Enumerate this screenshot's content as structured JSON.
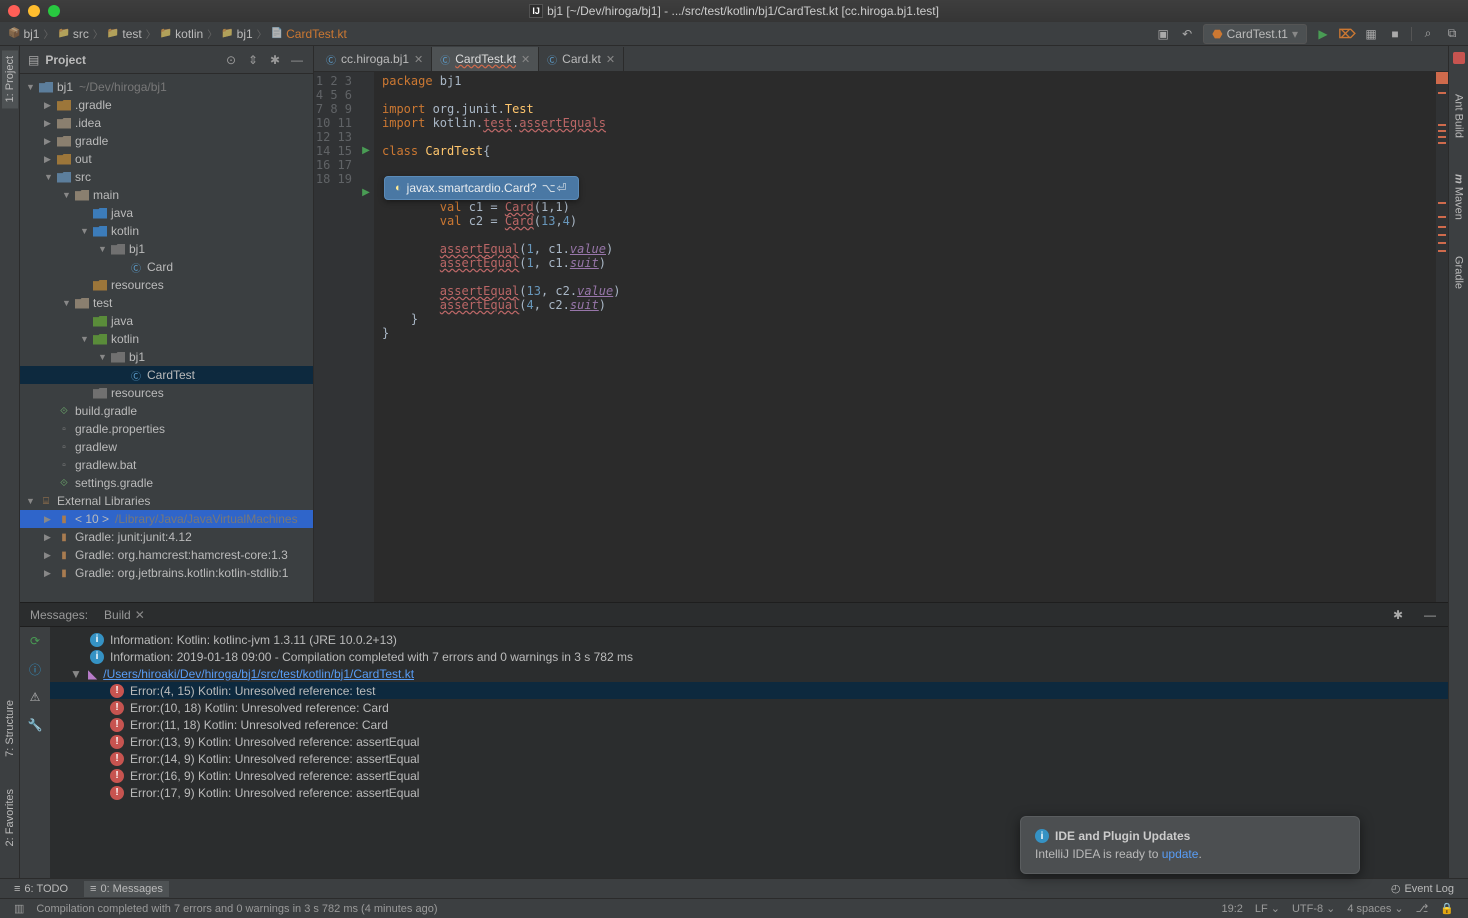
{
  "titlebar": {
    "title": "bj1 [~/Dev/hiroga/bj1] - .../src/test/kotlin/bj1/CardTest.kt [cc.hiroga.bj1.test]",
    "appIcon": "IJ"
  },
  "breadcrumb": [
    "bj1",
    "src",
    "test",
    "kotlin",
    "bj1",
    "CardTest.kt"
  ],
  "runConfig": {
    "label": "CardTest.t1"
  },
  "toolbarIcons": {
    "layout": "▣",
    "back": "↶",
    "run": "▶",
    "debug": "⌦",
    "coverage": "▦",
    "stop": "■",
    "search": "⌕",
    "structure": "⧉"
  },
  "projectPanel": {
    "title": "Project",
    "icons": {
      "target": "⊙",
      "collapse": "⇕",
      "gear": "✱",
      "hide": "—"
    },
    "tree": [
      {
        "d": 0,
        "arrow": "▼",
        "icon": "mod",
        "text": "bj1",
        "hint": "~/Dev/hiroga/bj1",
        "sel": false
      },
      {
        "d": 1,
        "arrow": "▶",
        "icon": "dirx",
        "text": ".gradle"
      },
      {
        "d": 1,
        "arrow": "▶",
        "icon": "dir",
        "text": ".idea"
      },
      {
        "d": 1,
        "arrow": "▶",
        "icon": "dir",
        "text": "gradle"
      },
      {
        "d": 1,
        "arrow": "▶",
        "icon": "dirx",
        "text": "out"
      },
      {
        "d": 1,
        "arrow": "▼",
        "icon": "mod",
        "text": "src"
      },
      {
        "d": 2,
        "arrow": "▼",
        "icon": "dir",
        "text": "main"
      },
      {
        "d": 3,
        "arrow": "",
        "icon": "src",
        "text": "java"
      },
      {
        "d": 3,
        "arrow": "▼",
        "icon": "src",
        "text": "kotlin"
      },
      {
        "d": 4,
        "arrow": "▼",
        "icon": "pkg",
        "text": "bj1"
      },
      {
        "d": 5,
        "arrow": "",
        "icon": "class",
        "text": "Card"
      },
      {
        "d": 3,
        "arrow": "",
        "icon": "res",
        "text": "resources"
      },
      {
        "d": 2,
        "arrow": "▼",
        "icon": "dir",
        "text": "test"
      },
      {
        "d": 3,
        "arrow": "",
        "icon": "test",
        "text": "java"
      },
      {
        "d": 3,
        "arrow": "▼",
        "icon": "test",
        "text": "kotlin"
      },
      {
        "d": 4,
        "arrow": "▼",
        "icon": "pkg",
        "text": "bj1"
      },
      {
        "d": 5,
        "arrow": "",
        "icon": "class",
        "text": "CardTest",
        "sel": true
      },
      {
        "d": 3,
        "arrow": "",
        "icon": "resg",
        "text": "resources"
      },
      {
        "d": 1,
        "arrow": "",
        "icon": "gradle",
        "text": "build.gradle"
      },
      {
        "d": 1,
        "arrow": "",
        "icon": "file",
        "text": "gradle.properties"
      },
      {
        "d": 1,
        "arrow": "",
        "icon": "file",
        "text": "gradlew"
      },
      {
        "d": 1,
        "arrow": "",
        "icon": "file",
        "text": "gradlew.bat"
      },
      {
        "d": 1,
        "arrow": "",
        "icon": "gradle",
        "text": "settings.gradle"
      },
      {
        "d": 0,
        "arrow": "▼",
        "icon": "lib",
        "text": "External Libraries"
      },
      {
        "d": 1,
        "arrow": "▶",
        "icon": "jar",
        "text": "< 10 >",
        "hint": "/Library/Java/JavaVirtualMachines",
        "sel": "hl"
      },
      {
        "d": 1,
        "arrow": "▶",
        "icon": "jar",
        "text": "Gradle: junit:junit:4.12"
      },
      {
        "d": 1,
        "arrow": "▶",
        "icon": "jar",
        "text": "Gradle: org.hamcrest:hamcrest-core:1.3"
      },
      {
        "d": 1,
        "arrow": "▶",
        "icon": "jar",
        "text": "Gradle: org.jetbrains.kotlin:kotlin-stdlib:1"
      }
    ]
  },
  "editorTabs": [
    {
      "name": "cc.hiroga.bj1",
      "icon": "kt",
      "err": false,
      "active": false
    },
    {
      "name": "CardTest.kt",
      "icon": "kt",
      "err": true,
      "active": true
    },
    {
      "name": "Card.kt",
      "icon": "kt",
      "err": false,
      "active": false
    }
  ],
  "code": {
    "lines": 19,
    "runMarkers": [
      6,
      9
    ],
    "tokens": [
      [
        [
          "kw",
          "package"
        ],
        [
          "pkg",
          " bj1"
        ]
      ],
      [],
      [
        [
          "kw",
          "import"
        ],
        [
          "pkg",
          " org.junit."
        ],
        [
          "cls",
          "Test"
        ]
      ],
      [
        [
          "kw",
          "import"
        ],
        [
          "pkg",
          " kotlin."
        ],
        [
          "unres",
          "test"
        ],
        [
          "pkg",
          "."
        ],
        [
          "unres",
          "assertEquals"
        ]
      ],
      [],
      [
        [
          "kw",
          "class"
        ],
        [
          "pkg",
          " "
        ],
        [
          "cls",
          "CardTest"
        ],
        [
          "pkg",
          "{"
        ]
      ],
      [],
      [],
      [],
      [
        [
          "pkg",
          "        "
        ],
        [
          "kw",
          "val"
        ],
        [
          "pkg",
          " c1 = "
        ],
        [
          "unres",
          "Card"
        ],
        [
          "pkg",
          "(1,1)"
        ]
      ],
      [
        [
          "pkg",
          "        "
        ],
        [
          "kw",
          "val"
        ],
        [
          "pkg",
          " c2 = "
        ],
        [
          "unres",
          "Card"
        ],
        [
          "pkg",
          "("
        ],
        [
          "num",
          "13"
        ],
        [
          "pkg",
          ","
        ],
        [
          "num",
          "4"
        ],
        [
          "pkg",
          ")"
        ]
      ],
      [],
      [
        [
          "pkg",
          "        "
        ],
        [
          "unres",
          "assertEqual"
        ],
        [
          "pkg",
          "("
        ],
        [
          "num",
          "1"
        ],
        [
          "pkg",
          ", c1."
        ],
        [
          "field-it",
          "value"
        ],
        [
          "pkg",
          ")"
        ]
      ],
      [
        [
          "pkg",
          "        "
        ],
        [
          "unres",
          "assertEqual"
        ],
        [
          "pkg",
          "("
        ],
        [
          "num",
          "1"
        ],
        [
          "pkg",
          ", c1."
        ],
        [
          "field-it",
          "suit"
        ],
        [
          "pkg",
          ")"
        ]
      ],
      [],
      [
        [
          "pkg",
          "        "
        ],
        [
          "unres",
          "assertEqual"
        ],
        [
          "pkg",
          "("
        ],
        [
          "num",
          "13"
        ],
        [
          "pkg",
          ", c2."
        ],
        [
          "field-it",
          "value"
        ],
        [
          "pkg",
          ")"
        ]
      ],
      [
        [
          "pkg",
          "        "
        ],
        [
          "unres",
          "assertEqual"
        ],
        [
          "pkg",
          "("
        ],
        [
          "num",
          "4"
        ],
        [
          "pkg",
          ", c2."
        ],
        [
          "field-it",
          "suit"
        ],
        [
          "pkg",
          ")"
        ]
      ],
      [
        [
          "pkg",
          "    }"
        ]
      ],
      [
        [
          "pkg",
          "}"
        ]
      ]
    ]
  },
  "hint": {
    "text": "javax.smartcardio.Card?",
    "shortcut": "⌥⏎"
  },
  "messages": {
    "tabs": [
      "Messages:",
      "Build"
    ],
    "rows": [
      {
        "d": 1,
        "icon": "info",
        "text": "Information: Kotlin: kotlinc-jvm 1.3.11 (JRE 10.0.2+13)"
      },
      {
        "d": 1,
        "icon": "info",
        "text": "Information: 2019-01-18 09:00 - Compilation completed with 7 errors and 0 warnings in 3 s 782 ms"
      },
      {
        "d": 0,
        "icon": "kt",
        "text": "/Users/hiroaki/Dev/hiroga/bj1/src/test/kotlin/bj1/CardTest.kt",
        "arrow": "▼"
      },
      {
        "d": 2,
        "icon": "err",
        "text": "Error:(4, 15)  Kotlin: Unresolved reference: test",
        "sel": true
      },
      {
        "d": 2,
        "icon": "err",
        "text": "Error:(10, 18)  Kotlin: Unresolved reference: Card"
      },
      {
        "d": 2,
        "icon": "err",
        "text": "Error:(11, 18)  Kotlin: Unresolved reference: Card"
      },
      {
        "d": 2,
        "icon": "err",
        "text": "Error:(13, 9)  Kotlin: Unresolved reference: assertEqual"
      },
      {
        "d": 2,
        "icon": "err",
        "text": "Error:(14, 9)  Kotlin: Unresolved reference: assertEqual"
      },
      {
        "d": 2,
        "icon": "err",
        "text": "Error:(16, 9)  Kotlin: Unresolved reference: assertEqual"
      },
      {
        "d": 2,
        "icon": "err",
        "text": "Error:(17, 9)  Kotlin: Unresolved reference: assertEqual"
      }
    ]
  },
  "updateBalloon": {
    "title": "IDE and Plugin Updates",
    "body_pre": "IntelliJ IDEA is ready to ",
    "link": "update",
    "body_post": "."
  },
  "leftGutter": {
    "proj": "1: Project",
    "struct": "7: Structure",
    "fav": "2: Favorites"
  },
  "rightGutter": {
    "ant": "Ant Build",
    "maven": "Maven",
    "gradle": "Gradle"
  },
  "bottomTabs": {
    "todo": "6: TODO",
    "messages": "0: Messages",
    "eventlog": "Event Log"
  },
  "status": {
    "text": "Compilation completed with 7 errors and 0 warnings in 3 s 782 ms (4 minutes ago)",
    "pos": "19:2",
    "sep": "LF",
    "enc": "UTF-8",
    "indent": "4 spaces",
    "git": "⎇",
    "lock": "🔒"
  }
}
